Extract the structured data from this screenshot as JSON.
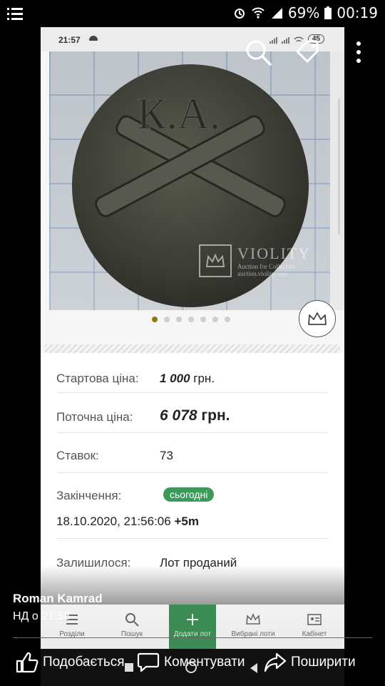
{
  "outer_status": {
    "battery_percent": "69%",
    "time": "00:19"
  },
  "inner_status": {
    "time": "21:57",
    "battery_level": "45"
  },
  "photo": {
    "coin_lettering": "К.А.",
    "watermark_title": "VIOLITY",
    "watermark_sub1": "Auction for Collectors",
    "watermark_sub2": "auction.violity.com"
  },
  "gallery": {
    "dot_count": 7,
    "active_dot": 0
  },
  "lot": {
    "start_price_label": "Стартова ціна:",
    "start_price_value": "1 000",
    "start_price_currency": "грн.",
    "current_price_label": "Поточна ціна:",
    "current_price_value": "6 078",
    "current_price_currency": "грн.",
    "bids_label": "Ставок:",
    "bids_value": "73",
    "end_label": "Закінчення:",
    "end_badge": "сьогодні",
    "end_date": "18.10.2020, 21:56:06",
    "end_extra": "+5m",
    "remaining_label": "Залишилося:",
    "remaining_value": "Лот проданий"
  },
  "bottom_nav": {
    "sections": "Розділи",
    "search": "Пошук",
    "add_lot": "Додати лот",
    "favorites": "Вибрані лоти",
    "cabinet": "Кабінет"
  },
  "post": {
    "author": "Roman Kamrad",
    "time": "НД о 21:58"
  },
  "actions": {
    "like": "Подобається",
    "comment": "Коментувати",
    "share": "Поширити"
  },
  "colors": {
    "accent_green": "#3c8b55",
    "badge_green": "#3a9a5a",
    "active_dot": "#8c7a14"
  }
}
